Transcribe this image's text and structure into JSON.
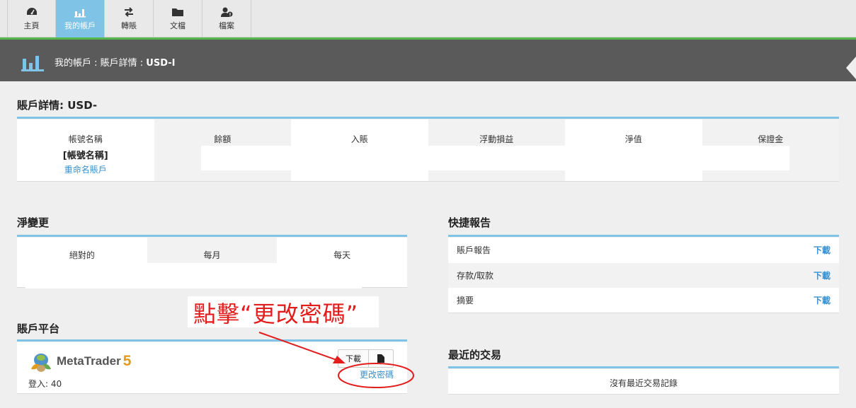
{
  "nav": {
    "items": [
      {
        "label": "主頁",
        "icon": "dashboard-icon"
      },
      {
        "label": "我的帳戶",
        "icon": "bar-chart-icon"
      },
      {
        "label": "轉賬",
        "icon": "transfer-icon"
      },
      {
        "label": "文檔",
        "icon": "folder-icon"
      },
      {
        "label": "檔案",
        "icon": "user-profile-icon"
      }
    ],
    "active_index": 1
  },
  "header": {
    "prefix": "我的帳戶 : 賬戶詳情 : ",
    "currency": "USD-I"
  },
  "details": {
    "title": "賬戶詳情: USD-",
    "columns": [
      "帳號名稱",
      "餘額",
      "入賬",
      "浮動損益",
      "淨值",
      "保證金"
    ],
    "account_name": "[帳號名稱]",
    "rename_link": "重命名賬戶"
  },
  "net_change": {
    "title": "淨變更",
    "columns": [
      "絕對的",
      "每月",
      "每天"
    ]
  },
  "quick_reports": {
    "title": "快捷報告",
    "rows": [
      {
        "label": "賬戶報告",
        "action": "下載"
      },
      {
        "label": "存款/取款",
        "action": "下載"
      },
      {
        "label": "摘要",
        "action": "下載"
      }
    ]
  },
  "platform": {
    "title": "賬戶平台",
    "logo_text": "MetaTrader",
    "logo_num": "5",
    "login_label": "登入: 40",
    "download_btn": "下載",
    "file_icon": "file-icon",
    "change_password": "更改密碼"
  },
  "recent": {
    "title": "最近的交易",
    "empty_text": "沒有最近交易記錄"
  },
  "annotation": {
    "text": "點擊“更改密碼”",
    "color": "#e31c1c"
  },
  "colors": {
    "accent_blue": "#7fc3e6",
    "link_blue": "#3a8fcb",
    "green_bar": "#55b84d",
    "header_gray": "#5a5a5a"
  }
}
